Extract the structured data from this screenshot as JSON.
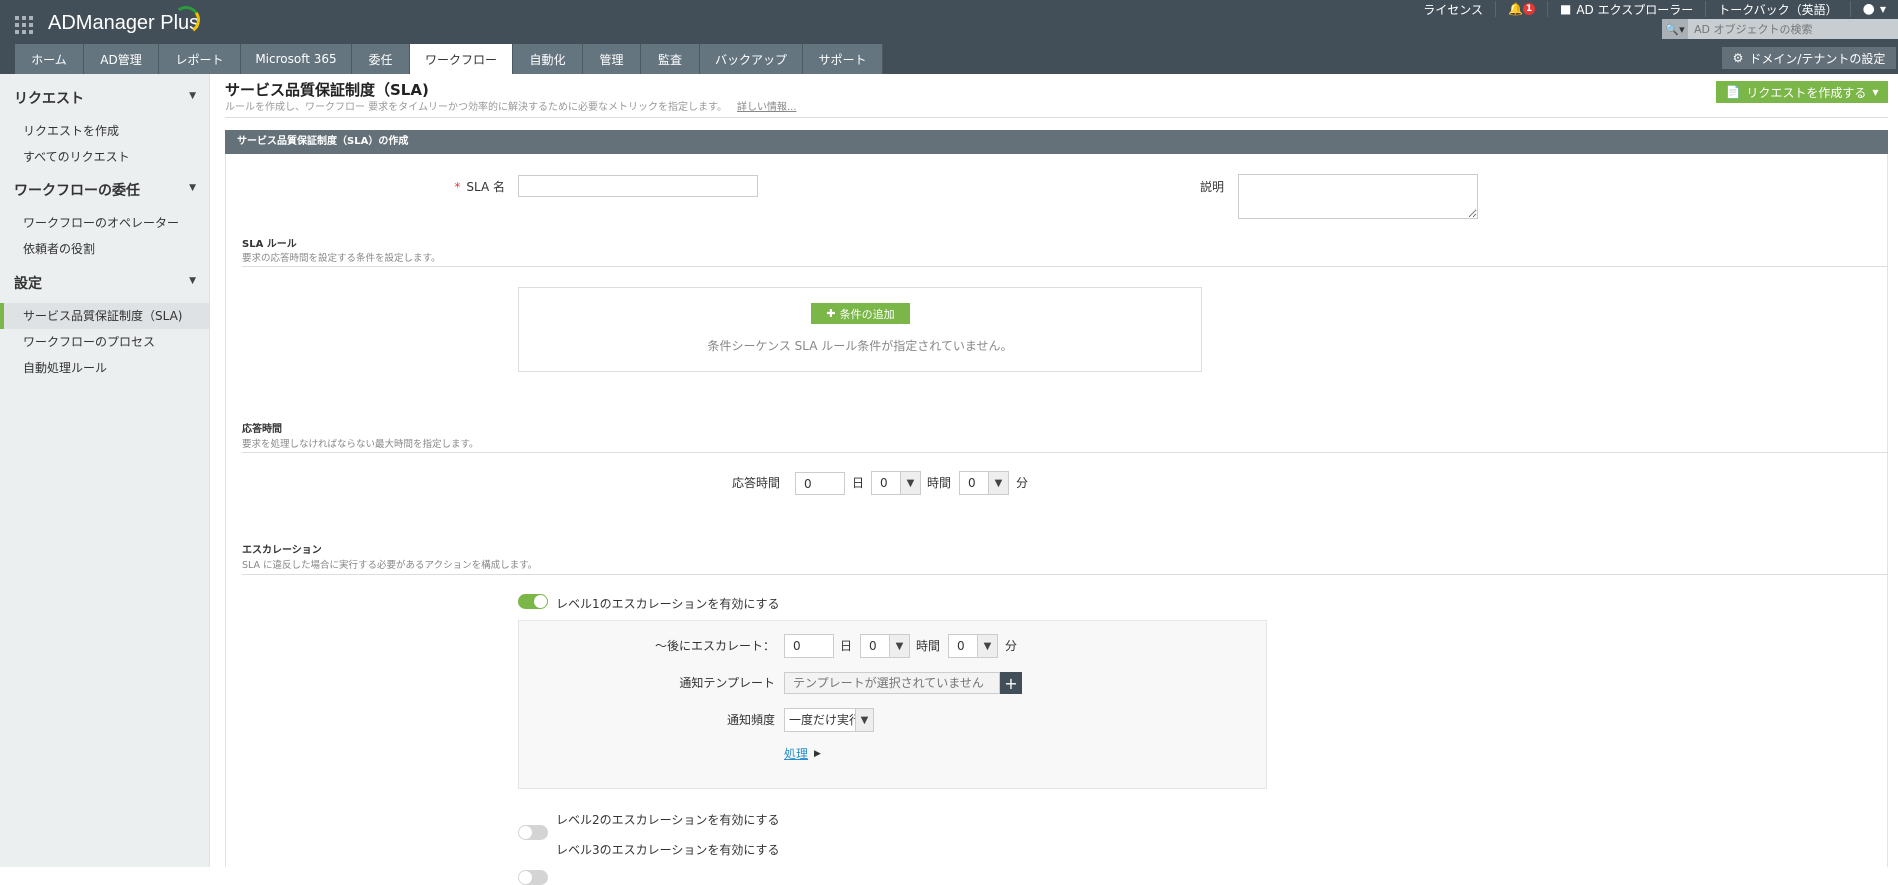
{
  "app": {
    "name": "ADManager Plus"
  },
  "header": {
    "license": "ライセンス",
    "notification_count": "1",
    "ad_explorer": "AD エクスプローラー",
    "talkback": "トークバック（英語）",
    "search_placeholder": "AD オブジェクトの検索",
    "domain_settings": "ドメイン/テナントの設定"
  },
  "tabs": [
    {
      "label": "ホーム"
    },
    {
      "label": "AD管理"
    },
    {
      "label": "レポート"
    },
    {
      "label": "Microsoft 365"
    },
    {
      "label": "委任"
    },
    {
      "label": "ワークフロー",
      "active": true
    },
    {
      "label": "自動化"
    },
    {
      "label": "管理"
    },
    {
      "label": "監査"
    },
    {
      "label": "バックアップ"
    },
    {
      "label": "サポート"
    }
  ],
  "sidebar": {
    "groups": [
      {
        "title": "リクエスト",
        "items": [
          "リクエストを作成",
          "すべてのリクエスト"
        ]
      },
      {
        "title": "ワークフローの委任",
        "items": [
          "ワークフローのオペレーター",
          "依頼者の役割"
        ]
      },
      {
        "title": "設定",
        "items": [
          "サービス品質保証制度（SLA)",
          "ワークフローのプロセス",
          "自動処理ルール"
        ]
      }
    ],
    "active_item": "サービス品質保証制度（SLA)"
  },
  "page": {
    "title": "サービス品質保証制度（SLA)",
    "description": "ルールを作成し、ワークフロー 要求をタイムリーかつ効率的に解決するために必要なメトリックを指定します。",
    "more_info": "詳しい情報...",
    "create_request": "リクエストを作成する"
  },
  "form": {
    "header": "サービス品質保証制度（SLA）の作成",
    "required_mark": "*",
    "sla_name_label": "SLA 名",
    "sla_name_value": "",
    "description_label": "説明",
    "description_value": "",
    "rules": {
      "title": "SLA ルール",
      "desc": "要求の応答時間を設定する条件を設定します。",
      "add_condition": "条件の追加",
      "empty": "条件シーケンス SLA ルール条件が指定されていません。"
    },
    "response": {
      "title": "応答時間",
      "desc": "要求を処理しなければならない最大時間を指定します。",
      "label": "応答時間",
      "days": "0",
      "days_unit": "日",
      "hours": "0",
      "hours_unit": "時間",
      "minutes": "0",
      "minutes_unit": "分"
    },
    "escalation": {
      "title": "エスカレーション",
      "desc": "SLA に違反した場合に実行する必要があるアクションを構成します。",
      "level1": {
        "label": "レベル1のエスカレーションを有効にする",
        "enabled": true
      },
      "level2": {
        "label": "レベル2のエスカレーションを有効にする",
        "enabled": false
      },
      "level3": {
        "label": "レベル3のエスカレーションを有効にする",
        "enabled": false
      },
      "after_label": "～後にエスカレート：",
      "days": "0",
      "days_unit": "日",
      "hours": "0",
      "hours_unit": "時間",
      "minutes": "0",
      "minutes_unit": "分",
      "template_label": "通知テンプレート",
      "template_placeholder": "テンプレートが選択されていません",
      "frequency_label": "通知頻度",
      "frequency_value": "一度だけ実行",
      "action_link": "処理"
    }
  },
  "colors": {
    "topbar": "#434f58",
    "tab": "#64757f",
    "accent_green": "#7ab648",
    "form_header": "#657179"
  }
}
